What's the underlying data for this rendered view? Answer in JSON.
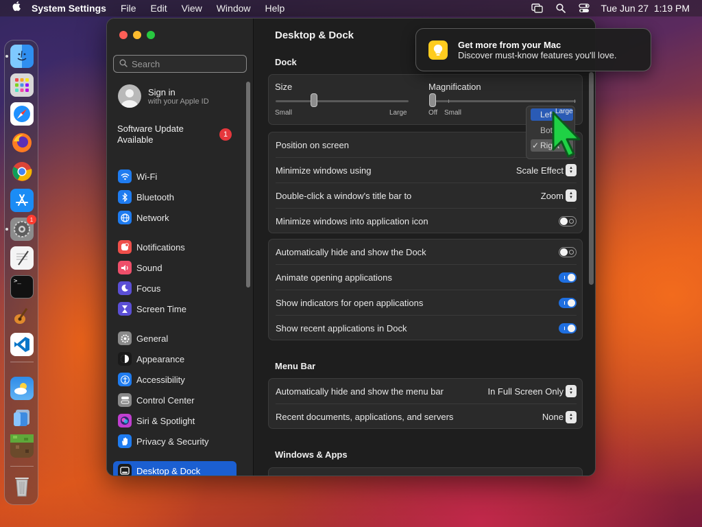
{
  "menubar": {
    "app_name": "System Settings",
    "menus": [
      "File",
      "Edit",
      "View",
      "Window",
      "Help"
    ],
    "clock": "Tue Jun 27  1:19 PM"
  },
  "dock": {
    "settings_badge": "1"
  },
  "sidebar": {
    "search_placeholder": "Search",
    "account": {
      "title": "Sign in",
      "subtitle": "with your Apple ID"
    },
    "software_update": {
      "label": "Software Update Available",
      "badge": "1"
    },
    "items": [
      {
        "label": "Wi-Fi",
        "icon": "wifi-icon",
        "color": "#1f7cf0"
      },
      {
        "label": "Bluetooth",
        "icon": "bluetooth-icon",
        "color": "#1f7cf0"
      },
      {
        "label": "Network",
        "icon": "globe-icon",
        "color": "#1f7cf0"
      },
      {
        "label": "Notifications",
        "icon": "bell-icon",
        "color": "#ef4f4a"
      },
      {
        "label": "Sound",
        "icon": "speaker-icon",
        "color": "#ef4f6a"
      },
      {
        "label": "Focus",
        "icon": "moon-icon",
        "color": "#5b4fd6"
      },
      {
        "label": "Screen Time",
        "icon": "hourglass-icon",
        "color": "#5b4fd6"
      },
      {
        "label": "General",
        "icon": "gear-icon",
        "color": "#8a8a8a"
      },
      {
        "label": "Appearance",
        "icon": "appearance-icon",
        "color": "#1a1a1a"
      },
      {
        "label": "Accessibility",
        "icon": "accessibility-icon",
        "color": "#1f7cf0"
      },
      {
        "label": "Control Center",
        "icon": "control-center-icon",
        "color": "#8a8a8a"
      },
      {
        "label": "Siri & Spotlight",
        "icon": "siri-icon",
        "color": "#c03fd0"
      },
      {
        "label": "Privacy & Security",
        "icon": "hand-icon",
        "color": "#1f7cf0"
      },
      {
        "label": "Desktop & Dock",
        "icon": "dock-icon",
        "color": "#1a1a1a",
        "selected": true
      }
    ]
  },
  "main": {
    "title": "Desktop & Dock",
    "dock_section": "Dock",
    "size": {
      "label": "Size",
      "min": "Small",
      "max": "Large",
      "value_fraction": 0.29
    },
    "magnification": {
      "label": "Magnification",
      "off": "Off",
      "min": "Small",
      "max": "Large",
      "value_fraction": 0.0
    },
    "popup_menu": {
      "items": [
        "Left",
        "Bottom",
        "Right"
      ],
      "highlighted": "Left",
      "checked": "Right"
    },
    "position_label": "Position on screen",
    "rows_group1": [
      {
        "label": "Minimize windows using",
        "value": "Scale Effect"
      },
      {
        "label": "Double-click a window's title bar to",
        "value": "Zoom"
      }
    ],
    "minimize_into_app": {
      "label": "Minimize windows into application icon",
      "on": false
    },
    "rows_group2": [
      {
        "label": "Automatically hide and show the Dock",
        "on": false
      },
      {
        "label": "Animate opening applications",
        "on": true
      },
      {
        "label": "Show indicators for open applications",
        "on": true
      },
      {
        "label": "Show recent applications in Dock",
        "on": true
      }
    ],
    "menubar_section": "Menu Bar",
    "rows_menubar": [
      {
        "label": "Automatically hide and show the menu bar",
        "value": "In Full Screen Only"
      },
      {
        "label": "Recent documents, applications, and servers",
        "value": "None"
      }
    ],
    "windows_section": "Windows & Apps"
  },
  "notification": {
    "title": "Get more from your Mac",
    "body": "Discover must-know features you'll love."
  }
}
